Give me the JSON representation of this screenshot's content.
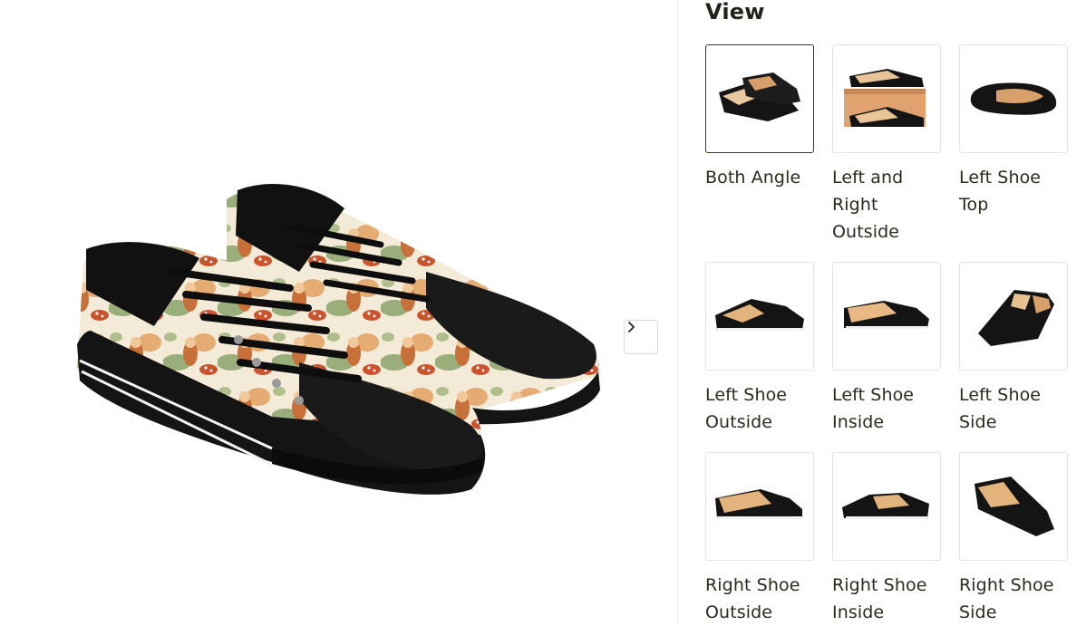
{
  "panel": {
    "title": "View"
  },
  "viewer": {
    "image_alt": "Both Angle",
    "next_icon": "chevron-right-icon"
  },
  "thumbnails": [
    {
      "label": "Both Angle",
      "active": true
    },
    {
      "label": "Left and Right Outside",
      "active": false
    },
    {
      "label": "Left Shoe Top",
      "active": false
    },
    {
      "label": "Left Shoe Outside",
      "active": false
    },
    {
      "label": "Left Shoe Inside",
      "active": false
    },
    {
      "label": "Left Shoe Side",
      "active": false
    },
    {
      "label": "Right Shoe Outside",
      "active": false
    },
    {
      "label": "Right Shoe Inside",
      "active": false
    },
    {
      "label": "Right Shoe Side",
      "active": false
    }
  ],
  "colors": {
    "shoe_black": "#141414",
    "sole_stripe": "#f2f2f2",
    "print_orange": "#d98a4a",
    "print_green": "#8aa36a",
    "print_cream": "#f3ead8"
  }
}
